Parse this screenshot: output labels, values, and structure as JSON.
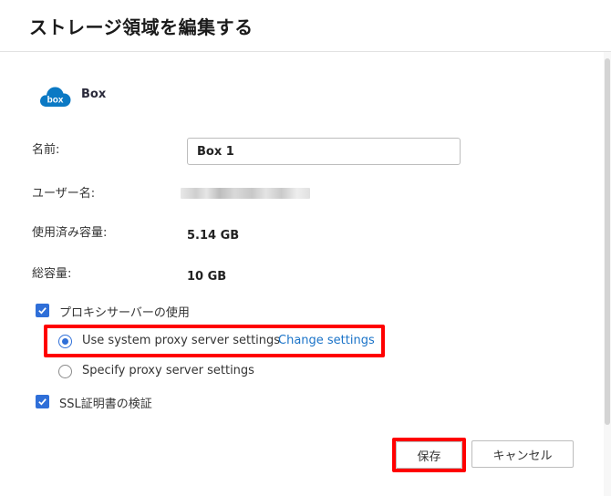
{
  "dialog": {
    "title": "ストレージ領域を編集する"
  },
  "provider": {
    "name": "Box",
    "logo_text": "box",
    "logo_color": "#0b79c4"
  },
  "fields": {
    "name_label": "名前:",
    "name_value": "Box 1",
    "username_label": "ユーザー名:",
    "used_label": "使用済み容量:",
    "used_value": "5.14 GB",
    "total_label": "総容量:",
    "total_value": "10 GB"
  },
  "proxy": {
    "checkbox_label": "プロキシサーバーの使用",
    "checked": true,
    "option_system": "Use system proxy server settings",
    "option_system_selected": true,
    "change_settings_link": "Change settings",
    "option_specify": "Specify proxy server settings",
    "option_specify_selected": false
  },
  "ssl": {
    "checkbox_label": "SSL証明書の検証",
    "checked": true
  },
  "buttons": {
    "save": "保存",
    "cancel": "キャンセル"
  },
  "colors": {
    "accent": "#2f6fd8",
    "link": "#1a73c8",
    "highlight": "#ff0000"
  }
}
